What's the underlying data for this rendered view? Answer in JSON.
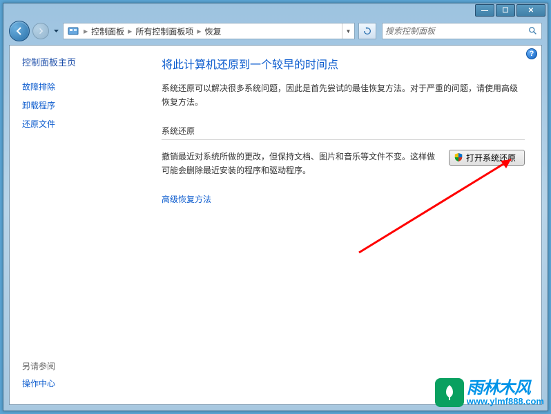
{
  "titlebar": {
    "min": "—",
    "max": "☐",
    "close": "✕"
  },
  "breadcrumb": {
    "seg1": "控制面板",
    "seg2": "所有控制面板项",
    "seg3": "恢复"
  },
  "search": {
    "placeholder": "搜索控制面板"
  },
  "sidebar": {
    "title": "控制面板主页",
    "links": [
      "故障排除",
      "卸载程序",
      "还原文件"
    ],
    "see_also": "另请参阅",
    "action_center": "操作中心"
  },
  "main": {
    "heading": "将此计算机还原到一个较早的时间点",
    "description": "系统还原可以解决很多系统问题，因此是首先尝试的最佳恢复方法。对于严重的问题，请使用高级恢复方法。",
    "section_title": "系统还原",
    "restore_text": "撤销最近对系统所做的更改，但保持文档、图片和音乐等文件不变。这样做可能会删除最近安装的程序和驱动程序。",
    "restore_button": "打开系统还原",
    "advanced_link": "高级恢复方法"
  },
  "watermark": {
    "cn": "雨林木风",
    "url": "www.ylmf888.com"
  }
}
